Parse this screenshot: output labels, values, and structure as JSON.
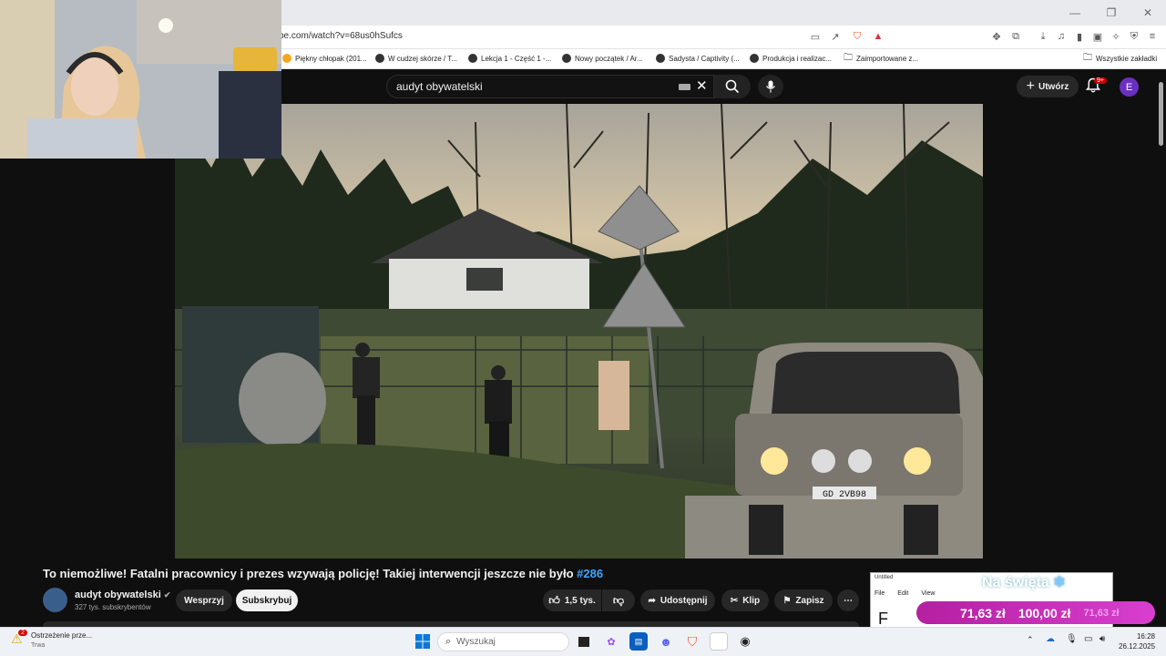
{
  "browser": {
    "url": "be.com/watch?v=68us0hSufcs",
    "bookmarks": [
      "Piękny chłopak (201...",
      "W cudzej skórze / T...",
      "Lekcja 1 - Część 1 -...",
      "Nowy początek / Ar...",
      "Sadysta / Captivity (...",
      "Produkcja i realizac...",
      "Zaimportowane z...",
      "Wszystkie zakładki"
    ]
  },
  "youtube": {
    "search_value": "audyt obywatelski",
    "create_label": "Utwórz",
    "notifications": "9+",
    "avatar_letter": "E"
  },
  "video": {
    "title": "To niemożliwe! Fatalni pracownicy i prezes wzywają policję! Takiej interwencji jeszcze nie było",
    "hashtag": "#286",
    "license_plate": "GD 2VB98"
  },
  "channel": {
    "name": "audyt obywatelski",
    "verified_icon": "check-circle-icon",
    "subscribers": "327 tys. subskrybentów",
    "support_label": "Wesprzyj",
    "subscribe_label": "Subskrybuj"
  },
  "actions": {
    "likes": "1,5 tys.",
    "share": "Udostępnij",
    "clip": "Klip",
    "save": "Zapisz"
  },
  "ad": {
    "window_title": "Untitled",
    "menu": [
      "File",
      "Edit",
      "View"
    ],
    "headline": "Na święta",
    "price_new": "71,63 zł",
    "price_old": "100,00 zł",
    "price_ghost": "71,63 zł",
    "body_letter": "F"
  },
  "taskbar": {
    "warning_title": "Ostrzeżenie prze...",
    "warning_sub": "Trwa",
    "warning_count": "2",
    "search_placeholder": "Wyszukaj",
    "time": "16:28",
    "date": "26.12.2025"
  }
}
